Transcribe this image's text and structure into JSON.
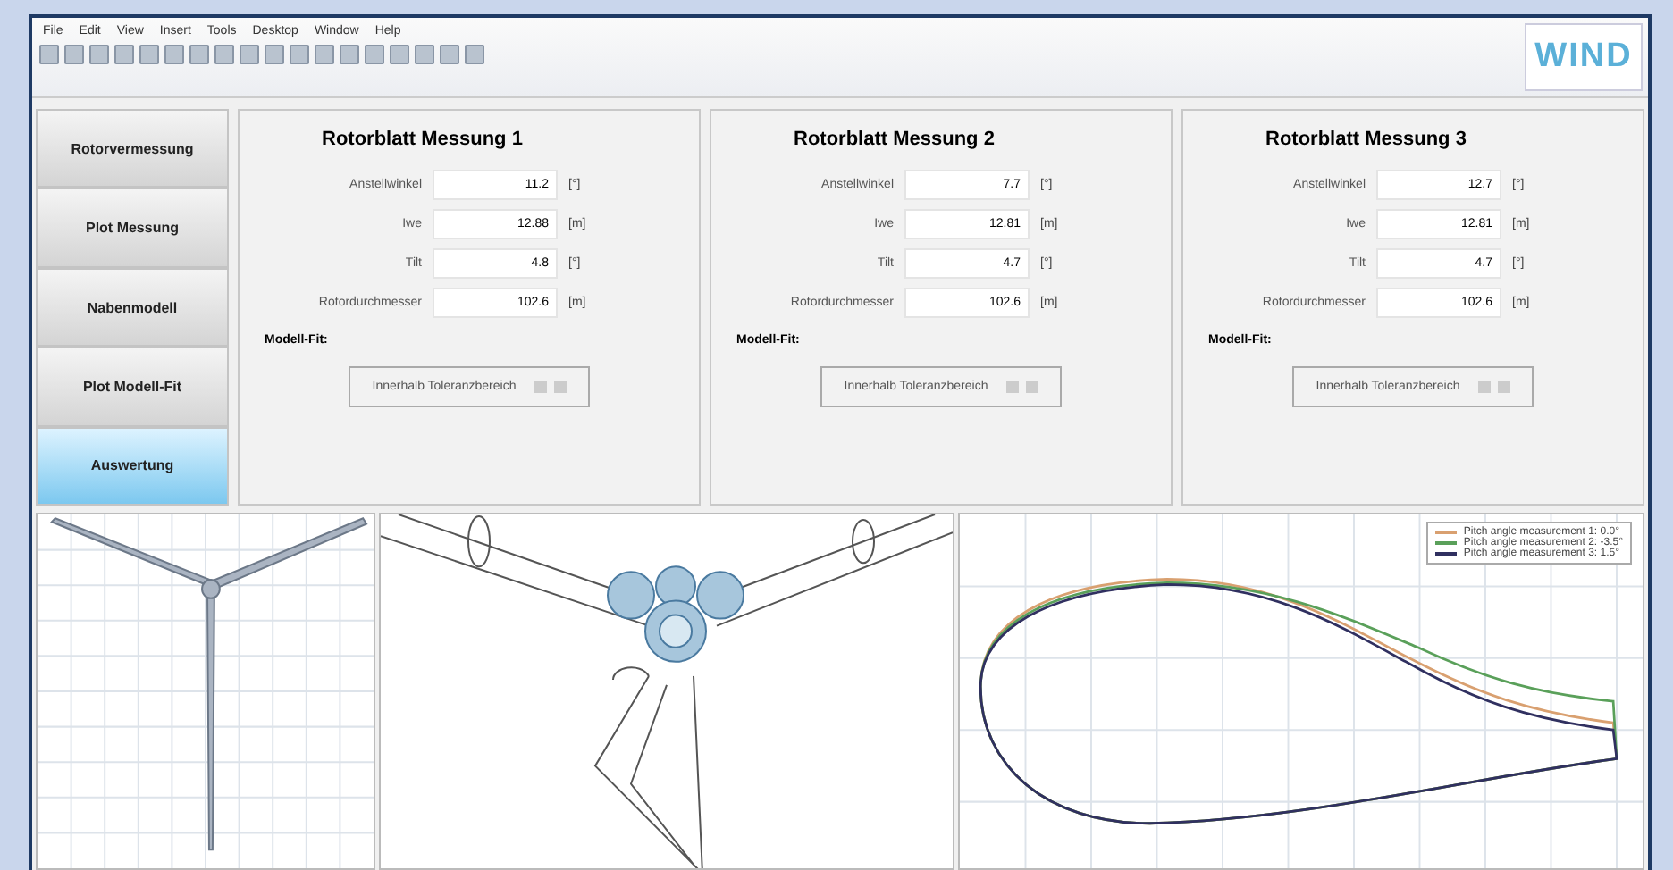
{
  "menu": [
    "File",
    "Edit",
    "View",
    "Insert",
    "Tools",
    "Desktop",
    "Window",
    "Help"
  ],
  "logo": {
    "text": "WIND"
  },
  "sidebar": [
    {
      "label": "Rotorvermessung",
      "selected": false
    },
    {
      "label": "Plot Messung",
      "selected": false
    },
    {
      "label": "Nabenmodell",
      "selected": false
    },
    {
      "label": "Plot Modell-Fit",
      "selected": false
    },
    {
      "label": "Auswertung",
      "selected": true
    }
  ],
  "panels": [
    {
      "title": "Rotorblatt Messung 1",
      "fields": [
        {
          "label": "Anstellwinkel",
          "value": "11.2",
          "unit": "[°]"
        },
        {
          "label": "Iwe",
          "value": "12.88",
          "unit": "[m]"
        },
        {
          "label": "Tilt",
          "value": "4.8",
          "unit": "[°]"
        },
        {
          "label": "Rotordurchmesser",
          "value": "102.6",
          "unit": "[m]"
        }
      ],
      "fit_label": "Modell-Fit:",
      "fit_status": "Innerhalb Toleranzbereich"
    },
    {
      "title": "Rotorblatt Messung 2",
      "fields": [
        {
          "label": "Anstellwinkel",
          "value": "7.7",
          "unit": "[°]"
        },
        {
          "label": "Iwe",
          "value": "12.81",
          "unit": "[m]"
        },
        {
          "label": "Tilt",
          "value": "4.7",
          "unit": "[°]"
        },
        {
          "label": "Rotordurchmesser",
          "value": "102.6",
          "unit": "[m]"
        }
      ],
      "fit_label": "Modell-Fit:",
      "fit_status": "Innerhalb Toleranzbereich"
    },
    {
      "title": "Rotorblatt Messung 3",
      "fields": [
        {
          "label": "Anstellwinkel",
          "value": "12.7",
          "unit": "[°]"
        },
        {
          "label": "Iwe",
          "value": "12.81",
          "unit": "[m]"
        },
        {
          "label": "Tilt",
          "value": "4.7",
          "unit": "[°]"
        },
        {
          "label": "Rotordurchmesser",
          "value": "102.6",
          "unit": "[m]"
        }
      ],
      "fit_label": "Modell-Fit:",
      "fit_status": "Innerhalb Toleranzbereich"
    }
  ],
  "profile_plot": {
    "legend": [
      {
        "label": "Pitch angle measurement 1:  0.0°",
        "color": "#d9a070"
      },
      {
        "label": "Pitch angle measurement 2: -3.5°",
        "color": "#5aa05a"
      },
      {
        "label": "Pitch angle measurement 3:  1.5°",
        "color": "#303060"
      }
    ]
  }
}
